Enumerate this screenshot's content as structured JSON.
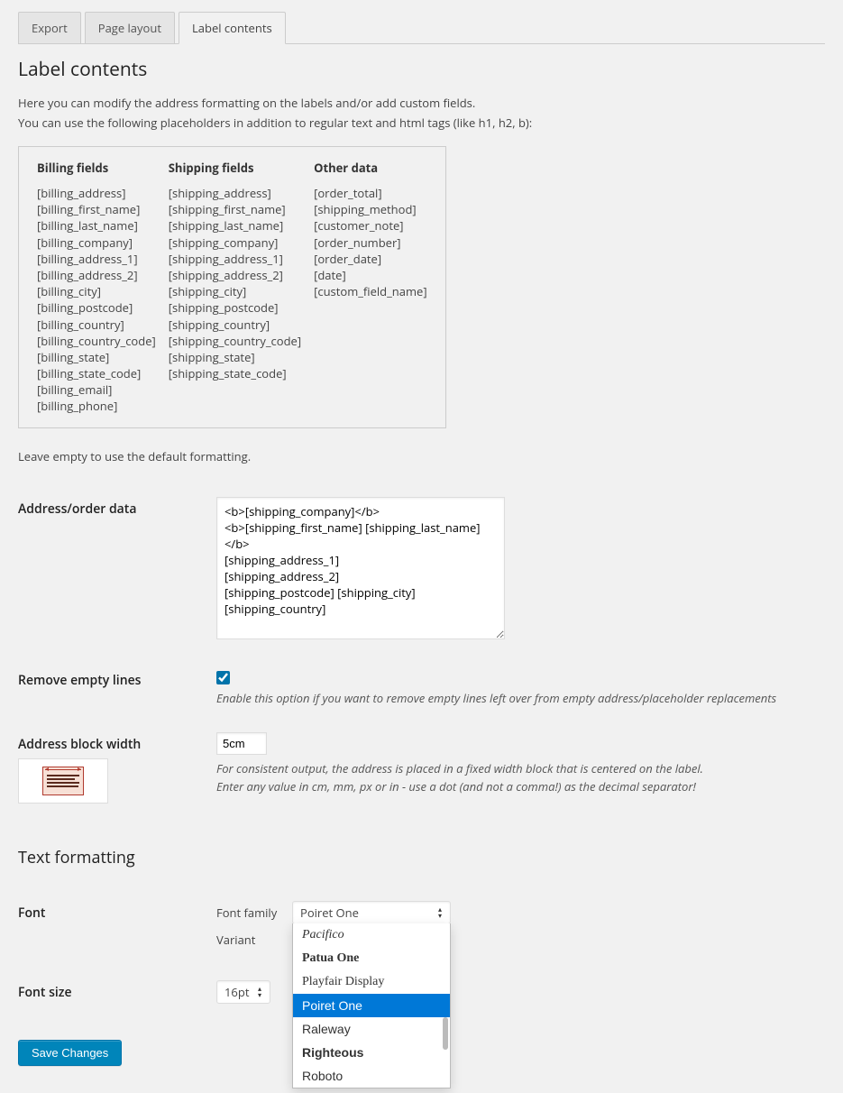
{
  "tabs": {
    "export": "Export",
    "page_layout": "Page layout",
    "label_contents": "Label contents"
  },
  "heading": "Label contents",
  "intro_line1": "Here you can modify the address formatting on the labels and/or add custom fields.",
  "intro_line2": "You can use the following placeholders in addition to regular text and html tags (like h1, h2, b):",
  "columns": {
    "billing": {
      "title": "Billing fields",
      "items": [
        "[billing_address]",
        "[billing_first_name]",
        "[billing_last_name]",
        "[billing_company]",
        "[billing_address_1]",
        "[billing_address_2]",
        "[billing_city]",
        "[billing_postcode]",
        "[billing_country]",
        "[billing_country_code]",
        "[billing_state]",
        "[billing_state_code]",
        "[billing_email]",
        "[billing_phone]"
      ]
    },
    "shipping": {
      "title": "Shipping fields",
      "items": [
        "[shipping_address]",
        "[shipping_first_name]",
        "[shipping_last_name]",
        "[shipping_company]",
        "[shipping_address_1]",
        "[shipping_address_2]",
        "[shipping_city]",
        "[shipping_postcode]",
        "[shipping_country]",
        "[shipping_country_code]",
        "[shipping_state]",
        "[shipping_state_code]"
      ]
    },
    "other": {
      "title": "Other data",
      "items": [
        "[order_total]",
        "[shipping_method]",
        "[customer_note]",
        "[order_number]",
        "[order_date]",
        "[date]",
        "[custom_field_name]"
      ]
    }
  },
  "after_box": "Leave empty to use the default formatting.",
  "address_data": {
    "label": "Address/order data",
    "value": "<b>[shipping_company]</b>\n<b>[shipping_first_name] [shipping_last_name]</b>\n[shipping_address_1]\n[shipping_address_2]\n[shipping_postcode] [shipping_city]\n[shipping_country]"
  },
  "remove_empty": {
    "label": "Remove empty lines",
    "checked": true,
    "desc": "Enable this option if you want to remove empty lines left over from empty address/placeholder replacements"
  },
  "block_width": {
    "label": "Address block width",
    "value": "5cm",
    "desc1": "For consistent output, the address is placed in a fixed width block that is centered on the label.",
    "desc2": "Enter any value in cm, mm, px or in - use a dot (and not a comma!) as the decimal separator!"
  },
  "text_formatting_heading": "Text formatting",
  "font": {
    "label": "Font",
    "family_label": "Font family",
    "family_value": "Poiret One",
    "variant_label": "Variant",
    "options": [
      "Pacifico",
      "Patua One",
      "Playfair Display",
      "Poiret One",
      "Raleway",
      "Righteous",
      "Roboto"
    ]
  },
  "font_size": {
    "label": "Font size",
    "value": "16pt"
  },
  "save_button": "Save Changes"
}
